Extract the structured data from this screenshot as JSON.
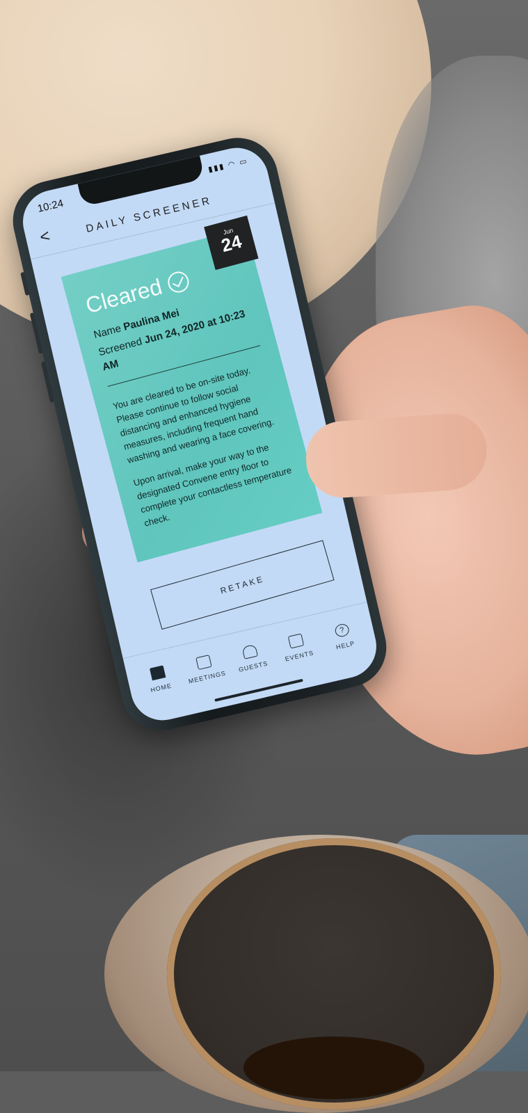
{
  "status": {
    "time": "10:24"
  },
  "header": {
    "title": "DAILY SCREENER",
    "back_label": "<"
  },
  "badge": {
    "month": "Jun",
    "day": "24"
  },
  "card": {
    "status": "Cleared",
    "name_label": "Name",
    "name_value": "Paulina Mei",
    "screened_label": "Screened",
    "screened_value": "Jun 24, 2020 at 10:23 AM",
    "message1": "You are cleared to be on-site today. Please continue to follow social distancing and enhanced hygiene measures, including frequent hand washing and wearing a face covering.",
    "message2": "Upon arrival, make your way to the designated Convene entry floor to complete your contactless temperature check."
  },
  "actions": {
    "retake_label": "RETAKE"
  },
  "tabbar": {
    "items": [
      {
        "label": "HOME",
        "icon": "home-icon"
      },
      {
        "label": "MEETINGS",
        "icon": "calendar-icon"
      },
      {
        "label": "GUESTS",
        "icon": "guests-icon"
      },
      {
        "label": "EVENTS",
        "icon": "events-icon"
      },
      {
        "label": "HELP",
        "icon": "help-icon"
      }
    ]
  },
  "colors": {
    "card": "#66cdc4",
    "screen": "#c3daf6",
    "badge": "#202224"
  }
}
